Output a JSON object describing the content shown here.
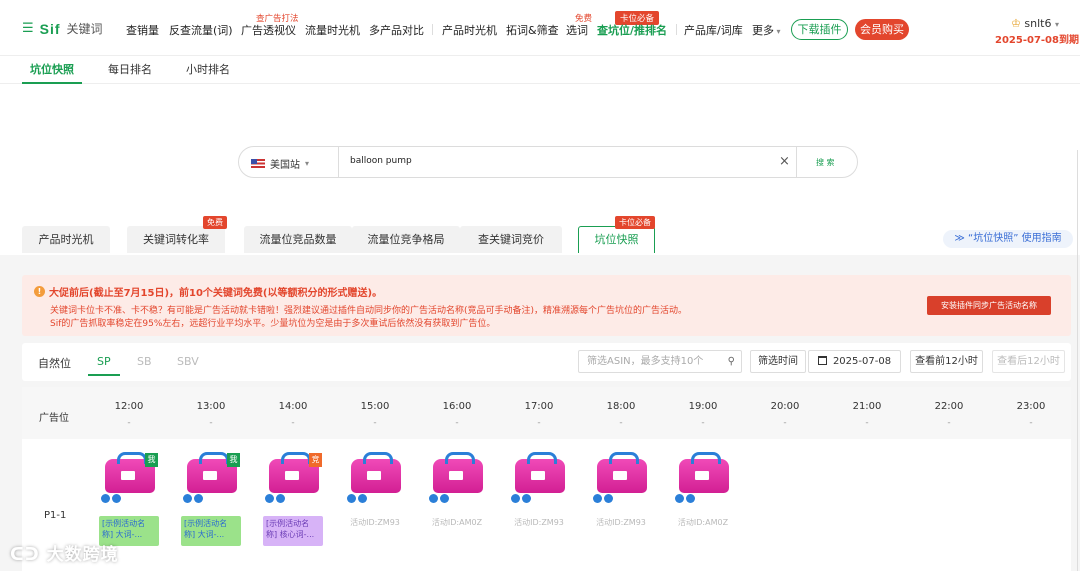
{
  "nav": {
    "logo_sif": "Sif",
    "logo_text": "关键词",
    "items": [
      "查销量",
      "反查流量(词)",
      "广告透视仪",
      "流量时光机",
      "多产品对比",
      "产品时光机",
      "拓词&筛查",
      "选词",
      "查坑位/推排名",
      "产品库/词库",
      "更多"
    ],
    "tags": {
      "ad": "查广告打法",
      "free": "免费",
      "hot": "卡位必备"
    },
    "download": "下载插件",
    "vip": "会员购买",
    "user": "snlt6",
    "expire": "2025-07-08到期"
  },
  "subnav": [
    "坑位快照",
    "每日排名",
    "小时排名"
  ],
  "search": {
    "country": "美国站",
    "value": "balloon pump",
    "button": "搜 索"
  },
  "tabs": [
    "产品时光机",
    "关键词转化率",
    "流量位竞品数量",
    "流量位竞争格局",
    "查关键词竞价",
    "坑位快照"
  ],
  "tab_tags": {
    "free": "免费",
    "hot": "卡位必备"
  },
  "guide": "“坑位快照” 使用指南",
  "notice": {
    "title": "大促前后(截止至7月15日)，前10个关键词免费(以等额积分的形式赠送)。",
    "line1": "关键词卡位卡不准、卡不稳？有可能是广告活动就卡错啦！强烈建议通过插件自动同步你的广告活动名称(竞品可手动备注)，精准溯源每个广告坑位的广告活动。",
    "line2": "Sif的广告抓取率稳定在95%左右，远超行业平均水平。少量坑位为空是由于多次重试后依然没有获取到广告位。",
    "button": "安装插件同步广告活动名称"
  },
  "filters": {
    "tabs": [
      "自然位",
      "SP",
      "SB",
      "SBV"
    ],
    "asin_placeholder": "筛选ASIN，最多支持10个",
    "time_label": "筛选时间",
    "date": "2025-07-08",
    "prev": "查看前12小时",
    "next": "查看后12小时"
  },
  "grid": {
    "slot_header": "广告位",
    "hours": [
      "12:00",
      "13:00",
      "14:00",
      "15:00",
      "16:00",
      "17:00",
      "18:00",
      "19:00",
      "20:00",
      "21:00",
      "22:00",
      "23:00"
    ],
    "dash": "-",
    "position": "P1-1",
    "cells": [
      {
        "corner": "我",
        "corner_color": "#1a9e52",
        "tag": "[示例活动名称] 大词-...",
        "tag_style": "green"
      },
      {
        "corner": "我",
        "corner_color": "#1a9e52",
        "tag": "[示例活动名称] 大词-...",
        "tag_style": "green"
      },
      {
        "corner": "竞",
        "corner_color": "#f06a2b",
        "tag": "[示例活动名称] 核心词-...",
        "tag_style": "purple"
      },
      {
        "corner": "",
        "tag": "活动ID:ZM93",
        "tag_style": "id"
      },
      {
        "corner": "",
        "tag": "活动ID:AM0Z",
        "tag_style": "id"
      },
      {
        "corner": "",
        "tag": "活动ID:ZM93",
        "tag_style": "id"
      },
      {
        "corner": "",
        "tag": "活动ID:ZM93",
        "tag_style": "id"
      },
      {
        "corner": "",
        "tag": "活动ID:AM0Z",
        "tag_style": "id"
      }
    ]
  },
  "watermark": "大数跨境"
}
